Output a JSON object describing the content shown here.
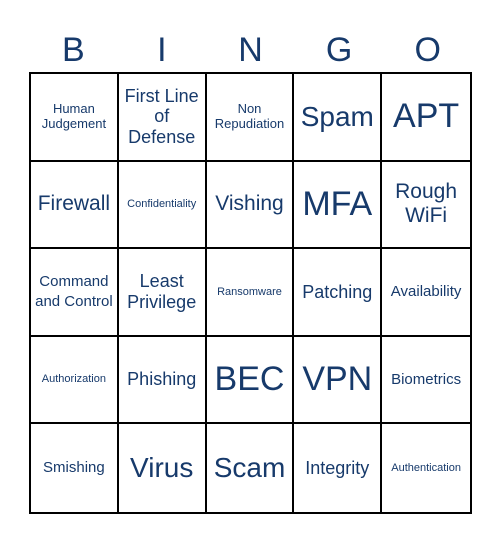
{
  "header": {
    "letters": [
      "B",
      "I",
      "N",
      "G",
      "O"
    ]
  },
  "colors": {
    "text": "#173a6b",
    "grid": "#000000",
    "background": "#ffffff"
  },
  "cells": [
    {
      "text": "Human Judgement",
      "size": "s-sm"
    },
    {
      "text": "First Line of Defense",
      "size": "s-lg"
    },
    {
      "text": "Non Repudiation",
      "size": "s-sm"
    },
    {
      "text": "Spam",
      "size": "s-xxl"
    },
    {
      "text": "APT",
      "size": "s-huge"
    },
    {
      "text": "Firewall",
      "size": "s-xl"
    },
    {
      "text": "Confidentiality",
      "size": "s-xs"
    },
    {
      "text": "Vishing",
      "size": "s-xl"
    },
    {
      "text": "MFA",
      "size": "s-huge"
    },
    {
      "text": "Rough WiFi",
      "size": "s-xl"
    },
    {
      "text": "Command and Control",
      "size": "s-md"
    },
    {
      "text": "Least Privilege",
      "size": "s-lg"
    },
    {
      "text": "Ransomware",
      "size": "s-xs"
    },
    {
      "text": "Patching",
      "size": "s-lg"
    },
    {
      "text": "Availability",
      "size": "s-md"
    },
    {
      "text": "Authorization",
      "size": "s-xs"
    },
    {
      "text": "Phishing",
      "size": "s-lg"
    },
    {
      "text": "BEC",
      "size": "s-huge"
    },
    {
      "text": "VPN",
      "size": "s-huge"
    },
    {
      "text": "Biometrics",
      "size": "s-md"
    },
    {
      "text": "Smishing",
      "size": "s-md"
    },
    {
      "text": "Virus",
      "size": "s-xxl"
    },
    {
      "text": "Scam",
      "size": "s-xxl"
    },
    {
      "text": "Integrity",
      "size": "s-lg"
    },
    {
      "text": "Authentication",
      "size": "s-xs"
    }
  ]
}
